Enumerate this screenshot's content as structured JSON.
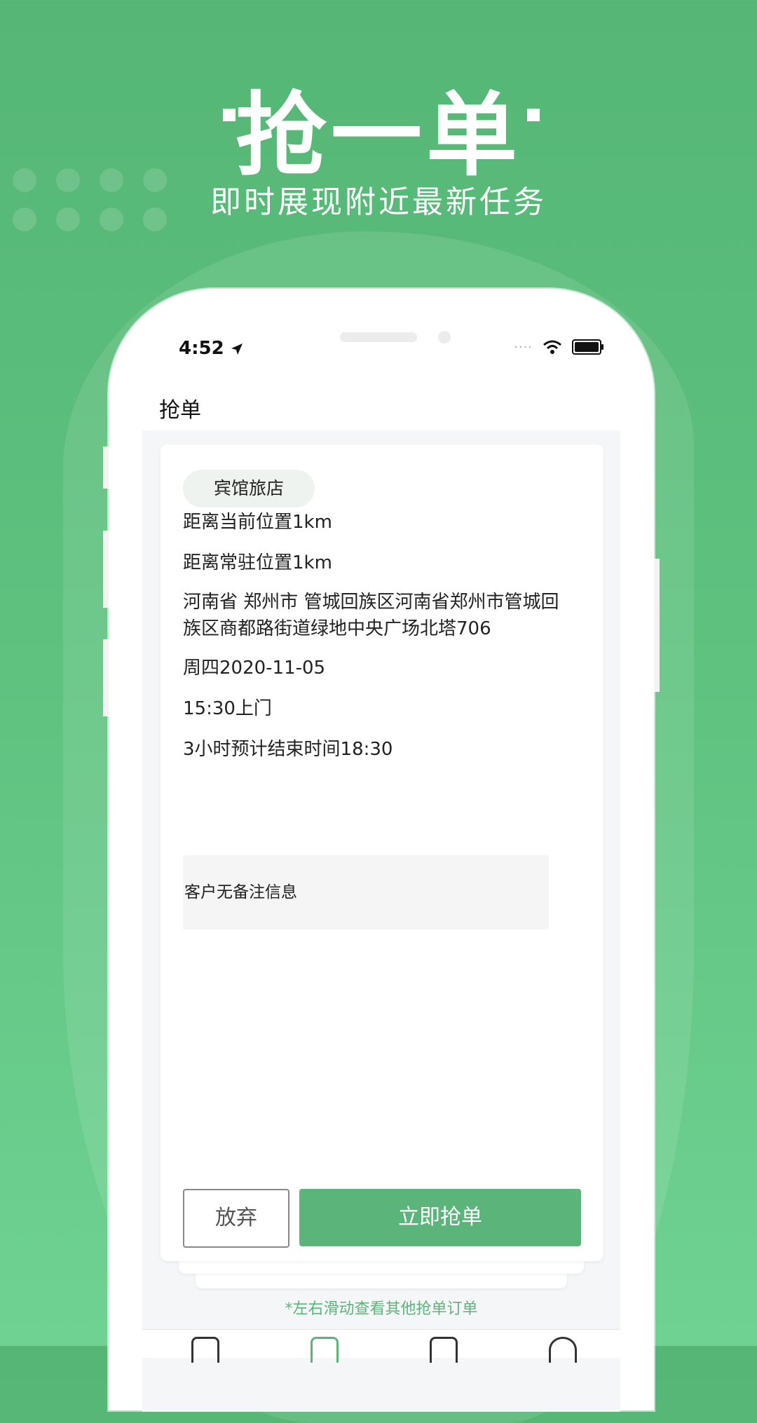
{
  "hero": {
    "title": "抢一单",
    "subtitle": "即时展现附近最新任务"
  },
  "status_bar": {
    "time": "4:52",
    "location_icon": "location-arrow-icon",
    "signal_icon": "signal-dots-icon",
    "wifi_icon": "wifi-icon",
    "battery_icon": "battery-icon"
  },
  "nav": {
    "title": "抢单"
  },
  "order": {
    "category": "宾馆旅店",
    "distance_current": "距离当前位置1km",
    "distance_resident": "距离常驻位置1km",
    "address": "河南省 郑州市 管城回族区河南省郑州市管城回族区商都路街道绿地中央广场北塔706",
    "date": "周四2020-11-05",
    "visit_time": "15:30上门",
    "duration": "3小时预计结束时间18:30",
    "remark": "客户无备注信息"
  },
  "actions": {
    "abandon": "放弃",
    "grab": "立即抢单"
  },
  "hint": "*左右滑动查看其他抢单订单",
  "colors": {
    "brand_green": "#5bb57a",
    "background_green": "#55b675"
  }
}
